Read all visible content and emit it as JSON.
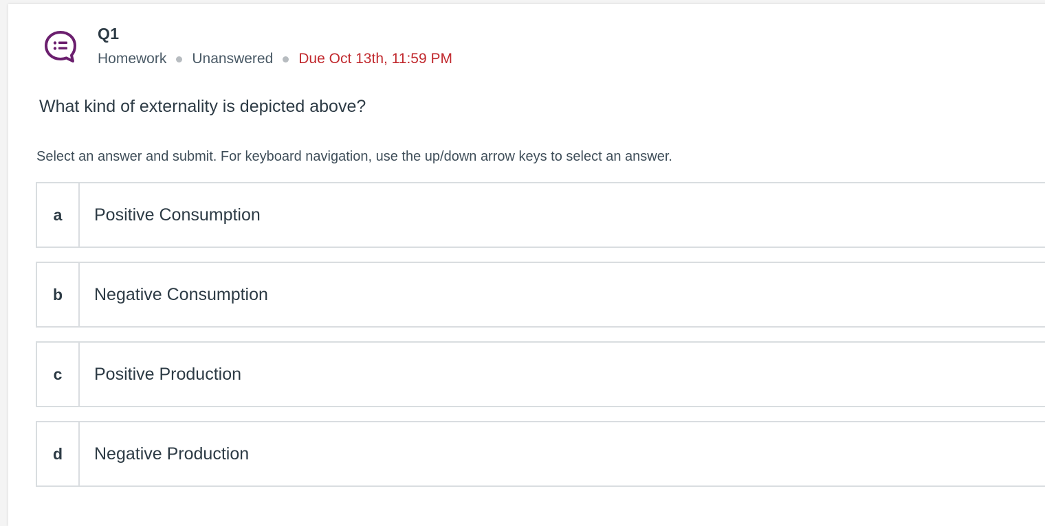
{
  "question": {
    "icon": "discussion-list-icon",
    "title": "Q1",
    "type": "Homework",
    "status": "Unanswered",
    "due": "Due Oct 13th, 11:59 PM",
    "prompt": "What kind of externality is depicted above?",
    "instructions": "Select an answer and submit. For keyboard navigation, use the up/down arrow keys to select an answer."
  },
  "answers": [
    {
      "letter": "a",
      "text": "Positive Consumption"
    },
    {
      "letter": "b",
      "text": "Negative Consumption"
    },
    {
      "letter": "c",
      "text": "Positive Production"
    },
    {
      "letter": "d",
      "text": "Negative Production"
    }
  ],
  "colors": {
    "icon": "#6b1f6e",
    "due": "#c1292e",
    "text": "#2d3b45",
    "border": "#d9dde0"
  }
}
